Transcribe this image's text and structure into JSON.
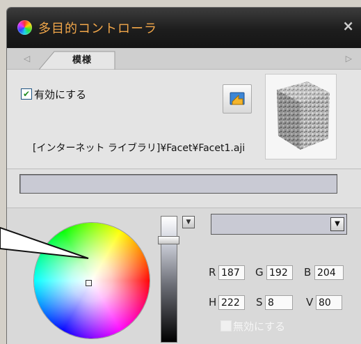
{
  "window": {
    "title": "多目的コントローラ",
    "close_label": "×"
  },
  "tabs": {
    "left_arrow": "◁",
    "right_arrow": "▷",
    "items": [
      {
        "label": "模様"
      }
    ]
  },
  "texture": {
    "enabled": true,
    "enable_label": "有効にする",
    "path": "[インターネット ライブラリ]¥Facet¥Facet1.aji",
    "thumbnail_icon": "stone-cube-icon",
    "import_icon": "folder-import-icon"
  },
  "name_field": {
    "value": ""
  },
  "color": {
    "preset_value": "",
    "preset_button_icon": "menu-triangle-icon",
    "select_arrow": "▼",
    "R": {
      "label": "R",
      "value": "187"
    },
    "G": {
      "label": "G",
      "value": "192"
    },
    "B": {
      "label": "B",
      "value": "204"
    },
    "H": {
      "label": "H",
      "value": "222"
    },
    "S": {
      "label": "S",
      "value": "8"
    },
    "V": {
      "label": "V",
      "value": "80"
    },
    "selected_hex": "#bbc0cc",
    "disable_label": "無効にする",
    "disable_checked": false
  }
}
